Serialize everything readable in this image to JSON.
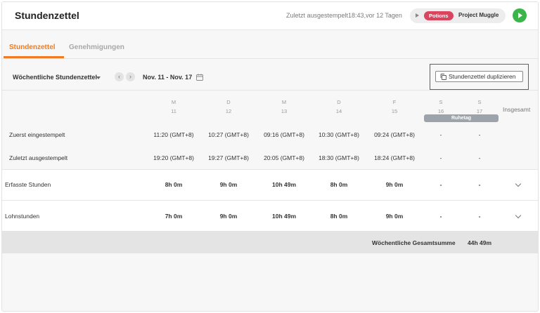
{
  "header": {
    "title": "Stundenzettel",
    "last_clock": "Zuletzt ausgestempelt18:43,vor 12 Tagen",
    "project_badge": "Potions",
    "project_name": "Project Muggle"
  },
  "tabs": [
    {
      "label": "Stundenzettel",
      "active": true
    },
    {
      "label": "Genehmigungen",
      "active": false
    }
  ],
  "toolbar": {
    "view": "Wöchentliche Stundenzettel",
    "prev": "‹",
    "next": "›",
    "date_range": "Nov. 11 - Nov. 17",
    "duplicate_label": "Stundenzettel duplizieren"
  },
  "days": [
    {
      "letter": "M",
      "num": "11"
    },
    {
      "letter": "D",
      "num": "12"
    },
    {
      "letter": "M",
      "num": "13"
    },
    {
      "letter": "D",
      "num": "14"
    },
    {
      "letter": "F",
      "num": "15"
    },
    {
      "letter": "S",
      "num": "16"
    },
    {
      "letter": "S",
      "num": "17"
    }
  ],
  "rest_day_label": "Ruhetag",
  "total_header": "Insgesamt",
  "rows": {
    "clock_in": {
      "label": "Zuerst eingestempelt",
      "values": [
        "11:20 (GMT+8)",
        "10:27 (GMT+8)",
        "09:16 (GMT+8)",
        "10:30 (GMT+8)",
        "09:24 (GMT+8)",
        "-",
        "-"
      ]
    },
    "clock_out": {
      "label": "Zuletzt ausgestempelt",
      "values": [
        "19:20 (GMT+8)",
        "19:27 (GMT+8)",
        "20:05 (GMT+8)",
        "18:30 (GMT+8)",
        "18:24 (GMT+8)",
        "-",
        "-"
      ]
    },
    "tracked": {
      "label": "Erfasste Stunden",
      "values": [
        "8h 0m",
        "9h 0m",
        "10h 49m",
        "8h 0m",
        "9h 0m",
        "-",
        "-"
      ]
    },
    "payroll": {
      "label": "Lohnstunden",
      "values": [
        "7h 0m",
        "9h 0m",
        "10h 49m",
        "8h 0m",
        "9h 0m",
        "-",
        "-"
      ]
    }
  },
  "summary": {
    "label": "Wöchentliche Gesamtsumme",
    "value": "44h 49m"
  },
  "colors": {
    "accent": "#f07b22",
    "badge": "#d9455e",
    "play": "#3ab54a",
    "highlight": "#e02a2a"
  }
}
